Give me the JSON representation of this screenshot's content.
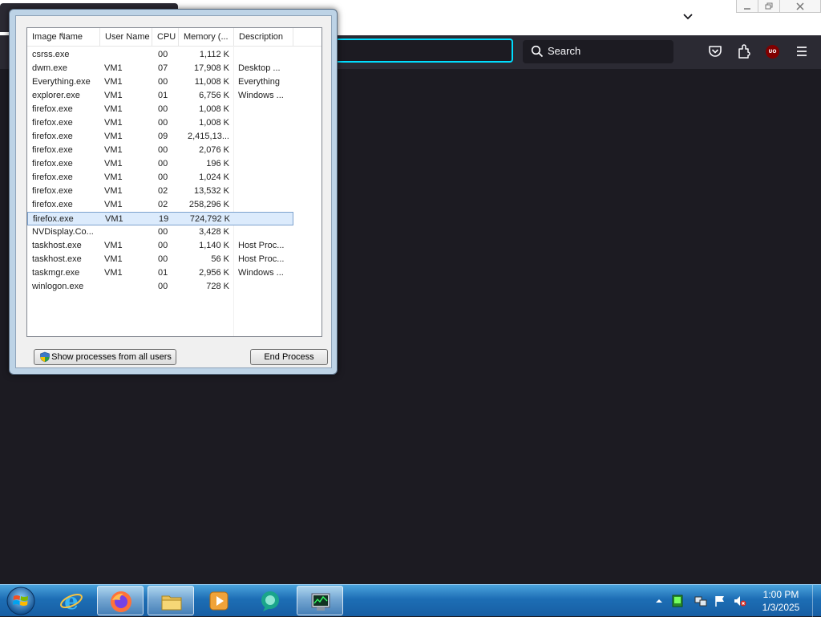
{
  "firefox": {
    "search_placeholder": "Search",
    "ublock_badge": "UO"
  },
  "task_manager": {
    "columns": [
      "Image Name",
      "User Name",
      "CPU",
      "Memory (...",
      "Description"
    ],
    "rows": [
      {
        "name": "csrss.exe",
        "user": "",
        "cpu": "00",
        "memory": "1,112 K",
        "description": ""
      },
      {
        "name": "dwm.exe",
        "user": "VM1",
        "cpu": "07",
        "memory": "17,908 K",
        "description": "Desktop ..."
      },
      {
        "name": "Everything.exe",
        "user": "VM1",
        "cpu": "00",
        "memory": "11,008 K",
        "description": "Everything"
      },
      {
        "name": "explorer.exe",
        "user": "VM1",
        "cpu": "01",
        "memory": "6,756 K",
        "description": "Windows ..."
      },
      {
        "name": "firefox.exe",
        "user": "VM1",
        "cpu": "00",
        "memory": "1,008 K",
        "description": ""
      },
      {
        "name": "firefox.exe",
        "user": "VM1",
        "cpu": "00",
        "memory": "1,008 K",
        "description": ""
      },
      {
        "name": "firefox.exe",
        "user": "VM1",
        "cpu": "09",
        "memory": "2,415,13...",
        "description": ""
      },
      {
        "name": "firefox.exe",
        "user": "VM1",
        "cpu": "00",
        "memory": "2,076 K",
        "description": ""
      },
      {
        "name": "firefox.exe",
        "user": "VM1",
        "cpu": "00",
        "memory": "196 K",
        "description": ""
      },
      {
        "name": "firefox.exe",
        "user": "VM1",
        "cpu": "00",
        "memory": "1,024 K",
        "description": ""
      },
      {
        "name": "firefox.exe",
        "user": "VM1",
        "cpu": "02",
        "memory": "13,532 K",
        "description": ""
      },
      {
        "name": "firefox.exe",
        "user": "VM1",
        "cpu": "02",
        "memory": "258,296 K",
        "description": ""
      },
      {
        "name": "firefox.exe",
        "user": "VM1",
        "cpu": "19",
        "memory": "724,792 K",
        "description": "",
        "selected": true
      },
      {
        "name": "NVDisplay.Co...",
        "user": "",
        "cpu": "00",
        "memory": "3,428 K",
        "description": ""
      },
      {
        "name": "taskhost.exe",
        "user": "VM1",
        "cpu": "00",
        "memory": "1,140 K",
        "description": "Host Proc..."
      },
      {
        "name": "taskhost.exe",
        "user": "VM1",
        "cpu": "00",
        "memory": "56 K",
        "description": "Host Proc..."
      },
      {
        "name": "taskmgr.exe",
        "user": "VM1",
        "cpu": "01",
        "memory": "2,956 K",
        "description": "Windows ..."
      },
      {
        "name": "winlogon.exe",
        "user": "",
        "cpu": "00",
        "memory": "728 K",
        "description": ""
      }
    ],
    "show_all_label": "Show processes from all users",
    "end_process_label": "End Process"
  },
  "taskbar": {
    "items": [
      "start-orb",
      "internet-explorer-icon",
      "firefox-icon",
      "file-explorer-icon",
      "media-player-icon",
      "chat-app-icon",
      "task-manager-icon"
    ],
    "active_item": "task-manager-icon",
    "clock_time": "1:00 PM",
    "clock_date": "1/3/2025"
  },
  "colors": {
    "firefox_dark": "#2b2a33",
    "firefox_bg": "#1c1b22",
    "url_focus": "#00ddff",
    "selection": "#dcebfc",
    "taskbar_blue": "#1d6eb5"
  }
}
